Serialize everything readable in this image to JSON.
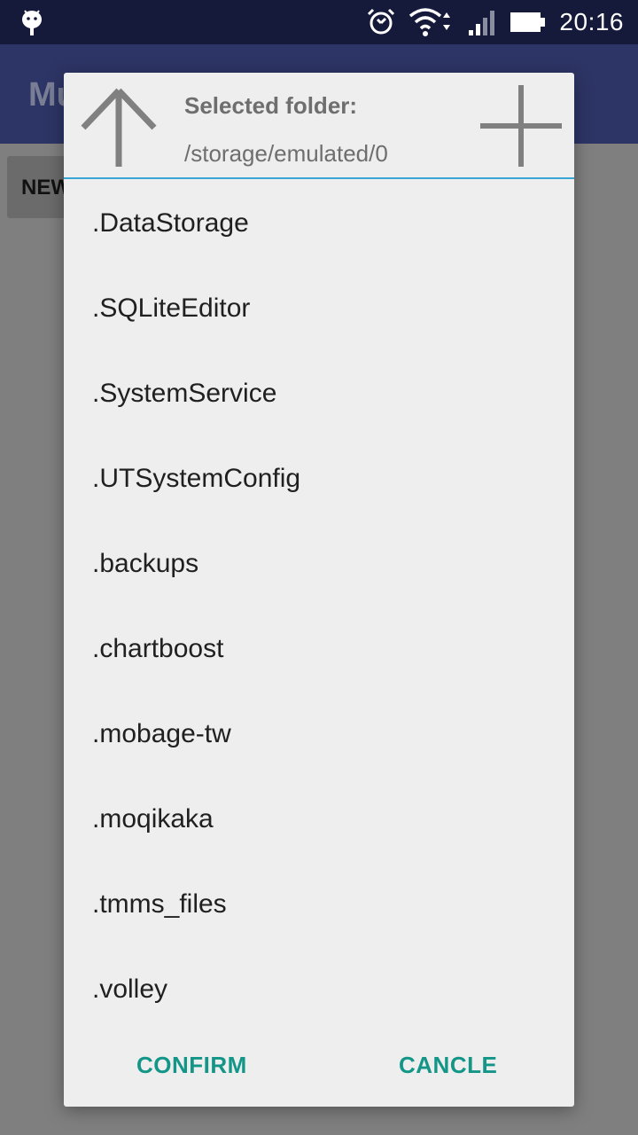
{
  "status_bar": {
    "time": "20:16",
    "icons": [
      "android-icon",
      "alarm-icon",
      "wifi-icon",
      "signal-icon",
      "battery-icon"
    ]
  },
  "app_bar": {
    "title": "Mu"
  },
  "background": {
    "button_label": "NEW"
  },
  "dialog": {
    "selected_label": "Selected folder:",
    "selected_path": "/storage/emulated/0",
    "header_icons": [
      "arrow-up-icon",
      "plus-icon"
    ],
    "folders": [
      ".DataStorage",
      ".SQLiteEditor",
      ".SystemService",
      ".UTSystemConfig",
      ".backups",
      ".chartboost",
      ".mobage-tw",
      ".moqikaka",
      ".tmms_files",
      ".volley"
    ],
    "confirm_label": "CONFIRM",
    "cancel_label": "CANCLE"
  },
  "colors": {
    "accent": "#139688",
    "divider": "#3aa6d6",
    "status_bar": "#15193a",
    "app_bar": "#2d3566"
  }
}
